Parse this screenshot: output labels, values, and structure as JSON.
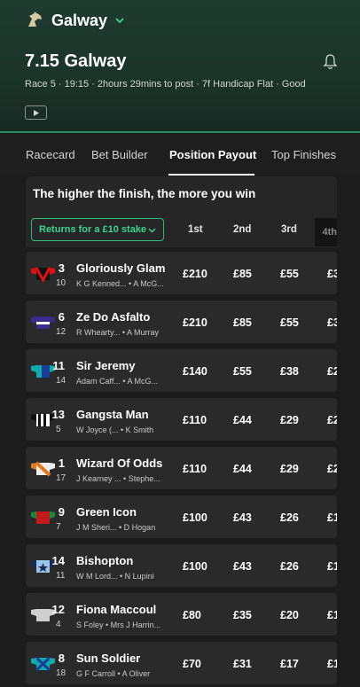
{
  "header": {
    "venue": "Galway",
    "race_title": "7.15 Galway",
    "meta": "Race 5 · 19:15 · 2hours 29mins to post · 7f Handicap Flat · Good"
  },
  "tabs": [
    "Racecard",
    "Bet Builder",
    "Position Payout",
    "Top Finishes"
  ],
  "active_tab": "Position Payout",
  "panel": {
    "title": "The higher the finish, the more you win",
    "stake_label": "Returns for a £10 stake",
    "positions": [
      "1st",
      "2nd",
      "3rd",
      "4th"
    ]
  },
  "runners": [
    {
      "num": "3",
      "draw": "10",
      "name": "Gloriously Glam",
      "jockey": "K G Kenned...",
      "trainer": "A McG...",
      "p1": "£210",
      "p2": "£85",
      "p3": "£55",
      "p4": "£3"
    },
    {
      "num": "6",
      "draw": "12",
      "name": "Ze Do Asfalto",
      "jockey": "R Whearty...",
      "trainer": "A Murray",
      "p1": "£210",
      "p2": "£85",
      "p3": "£55",
      "p4": "£3"
    },
    {
      "num": "11",
      "draw": "14",
      "name": "Sir Jeremy",
      "jockey": "Adam Caff...",
      "trainer": "A McG...",
      "p1": "£140",
      "p2": "£55",
      "p3": "£38",
      "p4": "£2"
    },
    {
      "num": "13",
      "draw": "5",
      "name": "Gangsta Man",
      "jockey": "W Joyce (...",
      "trainer": "K Smith",
      "p1": "£110",
      "p2": "£44",
      "p3": "£29",
      "p4": "£2"
    },
    {
      "num": "1",
      "draw": "17",
      "name": "Wizard Of Odds",
      "jockey": "J Kearney ...",
      "trainer": "Stephe...",
      "p1": "£110",
      "p2": "£44",
      "p3": "£29",
      "p4": "£2"
    },
    {
      "num": "9",
      "draw": "7",
      "name": "Green Icon",
      "jockey": "J M Sheri...",
      "trainer": "D Hogan",
      "p1": "£100",
      "p2": "£43",
      "p3": "£26",
      "p4": "£1"
    },
    {
      "num": "14",
      "draw": "11",
      "name": "Bishopton",
      "jockey": "W M Lord...",
      "trainer": "N Lupini",
      "p1": "£100",
      "p2": "£43",
      "p3": "£26",
      "p4": "£1"
    },
    {
      "num": "12",
      "draw": "4",
      "name": "Fiona Maccoul",
      "jockey": "S Foley",
      "trainer": "Mrs J Harrin...",
      "p1": "£80",
      "p2": "£35",
      "p3": "£20",
      "p4": "£1"
    },
    {
      "num": "8",
      "draw": "18",
      "name": "Sun Soldier",
      "jockey": "G F Carroll",
      "trainer": "A Oliver",
      "p1": "£70",
      "p2": "£31",
      "p3": "£17",
      "p4": "£1"
    }
  ],
  "colors": {
    "accent": "#2dbb7c",
    "header_bg": "#1f3b30",
    "row_bg": "#2a2a2a"
  }
}
